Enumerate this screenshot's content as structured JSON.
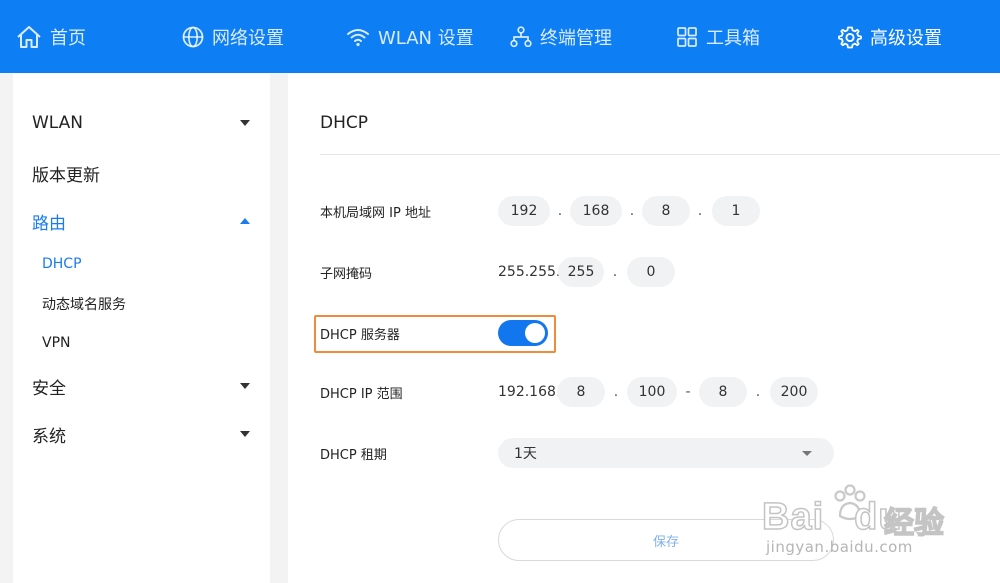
{
  "nav": {
    "items": [
      {
        "label": "首页",
        "icon": "home-icon"
      },
      {
        "label": "网络设置",
        "icon": "globe-icon"
      },
      {
        "label": "WLAN 设置",
        "icon": "wifi-icon"
      },
      {
        "label": "终端管理",
        "icon": "device-tree-icon"
      },
      {
        "label": "工具箱",
        "icon": "toolbox-grid-icon"
      },
      {
        "label": "高级设置",
        "icon": "gear-icon"
      }
    ],
    "active": "高级设置"
  },
  "sidebar": {
    "items": [
      {
        "label": "WLAN"
      },
      {
        "label": "版本更新"
      },
      {
        "label": "路由"
      },
      {
        "label": "安全"
      },
      {
        "label": "系统"
      }
    ],
    "route_children": [
      "DHCP",
      "动态域名服务",
      "VPN"
    ]
  },
  "main": {
    "title": "DHCP",
    "lan_ip": {
      "label": "本机局域网 IP 地址",
      "octets": [
        "192",
        "168",
        "8",
        "1"
      ],
      "dot": "."
    },
    "subnet": {
      "label": "子网掩码",
      "prefix": "255.255.",
      "octets": [
        "255",
        "0"
      ],
      "dot": "."
    },
    "dhcp_server": {
      "label": "DHCP 服务器",
      "enabled": true
    },
    "ip_range": {
      "label": "DHCP IP 范围",
      "prefix": "192.168.",
      "start": [
        "8",
        "100"
      ],
      "end": [
        "8",
        "200"
      ],
      "dash": "-",
      "dot": "."
    },
    "lease": {
      "label": "DHCP 租期",
      "value": "1天"
    },
    "save_label": "保存"
  },
  "watermark": {
    "brand": "Bai",
    "brand_suffix": "du",
    "cn": "经验",
    "url": "jingyan.baidu.com"
  },
  "colors": {
    "nav_bg": "#0d7ef3",
    "accent": "#1a7cf0",
    "highlight": "#f08a3c"
  }
}
